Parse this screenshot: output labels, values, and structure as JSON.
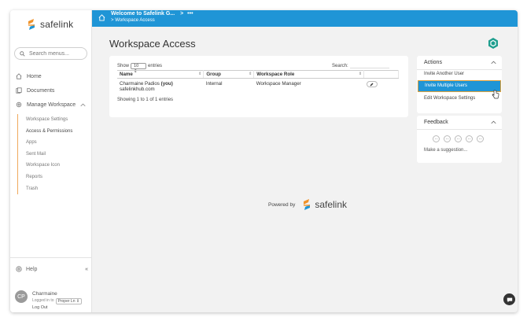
{
  "brand": {
    "name": "safelink",
    "accent": "#1f95d6",
    "logo_orange": "#f0932b",
    "logo_blue": "#1f95d6"
  },
  "sidebar": {
    "search_placeholder": "Search menus...",
    "items": [
      {
        "label": "Home",
        "icon": "home-icon"
      },
      {
        "label": "Documents",
        "icon": "documents-icon"
      },
      {
        "label": "Manage Workspace",
        "icon": "gear-icon"
      }
    ],
    "sub_items": [
      "Workspace Settings",
      "Access & Permissions",
      "Apps",
      "Sent Mail",
      "Workspace Icon",
      "Reports",
      "Trash"
    ],
    "help_label": "Help",
    "collapse_icon": "«",
    "user": {
      "initials": "CP",
      "name": "Charmaine",
      "logged_in_to": "Logged in to",
      "project": "Proper Ln",
      "logout": "Log Out"
    }
  },
  "topbar": {
    "crumb1": "Welcome to Safelink G...",
    "crumb1_sep": ">",
    "crumb1_more": "•••",
    "crumb2_sep": ">",
    "crumb2": "Workspace Access"
  },
  "main": {
    "title": "Workspace Access",
    "table": {
      "show_label": "Show",
      "show_value": "10",
      "entries_label": "entries",
      "search_label": "Search:",
      "columns": [
        "Name",
        "Group",
        "Workspace Role",
        ""
      ],
      "rows": [
        {
          "name": "Charmaine Padios",
          "you": "(you)",
          "email": "safelinkhub.com",
          "group": "Internal",
          "role": "Workspace Manager"
        }
      ],
      "showing": "Showing 1 to 1 of 1 entries"
    },
    "powered_by": "Powered by",
    "powered_logo": "safelink"
  },
  "actions": {
    "title": "Actions",
    "items": [
      "Invite Another User",
      "Invite Multiple Users",
      "Edit Workspace Settings"
    ],
    "highlighted": "Invite Multiple Users"
  },
  "feedback": {
    "title": "Feedback",
    "suggestion": "Make a suggestion..."
  }
}
